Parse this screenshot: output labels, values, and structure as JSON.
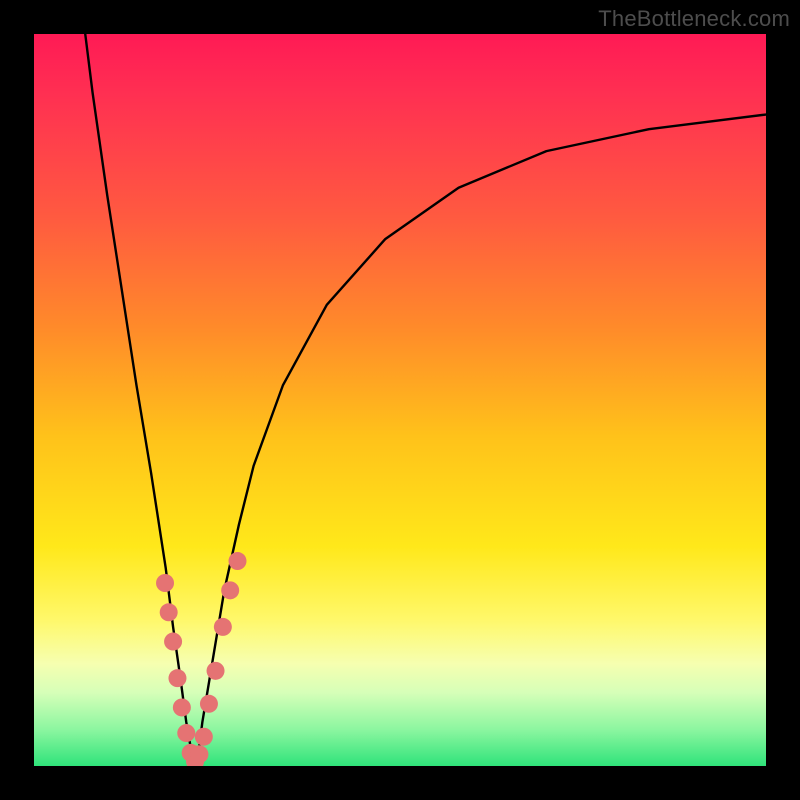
{
  "watermark": "TheBottleneck.com",
  "colors": {
    "frame": "#000000",
    "curve": "#000000",
    "marker_fill": "#e57373",
    "marker_stroke": "#c85a5a",
    "gradient_top": "#ff1a55",
    "gradient_bottom": "#2fe37a"
  },
  "chart_data": {
    "type": "line",
    "title": "",
    "xlabel": "",
    "ylabel": "",
    "xlim": [
      0,
      100
    ],
    "ylim": [
      0,
      100
    ],
    "series": [
      {
        "name": "curve",
        "x": [
          7,
          8,
          10,
          12,
          14,
          16,
          18,
          19,
          20,
          20.8,
          21.5,
          22,
          22.5,
          23,
          24,
          26,
          28,
          30,
          34,
          40,
          48,
          58,
          70,
          84,
          100
        ],
        "y": [
          100,
          92,
          78,
          65,
          52,
          40,
          27,
          19,
          12,
          6,
          2,
          0,
          2,
          6,
          12,
          24,
          33,
          41,
          52,
          63,
          72,
          79,
          84,
          87,
          89
        ]
      }
    ],
    "markers": [
      {
        "x": 17.9,
        "y": 25
      },
      {
        "x": 18.4,
        "y": 21
      },
      {
        "x": 19.0,
        "y": 17
      },
      {
        "x": 19.6,
        "y": 12
      },
      {
        "x": 20.2,
        "y": 8
      },
      {
        "x": 20.8,
        "y": 4.5
      },
      {
        "x": 21.4,
        "y": 1.8
      },
      {
        "x": 22.0,
        "y": 0.6
      },
      {
        "x": 22.6,
        "y": 1.6
      },
      {
        "x": 23.2,
        "y": 4.0
      },
      {
        "x": 23.9,
        "y": 8.5
      },
      {
        "x": 24.8,
        "y": 13
      },
      {
        "x": 25.8,
        "y": 19
      },
      {
        "x": 26.8,
        "y": 24
      },
      {
        "x": 27.8,
        "y": 28
      }
    ],
    "marker_radius": 9
  }
}
